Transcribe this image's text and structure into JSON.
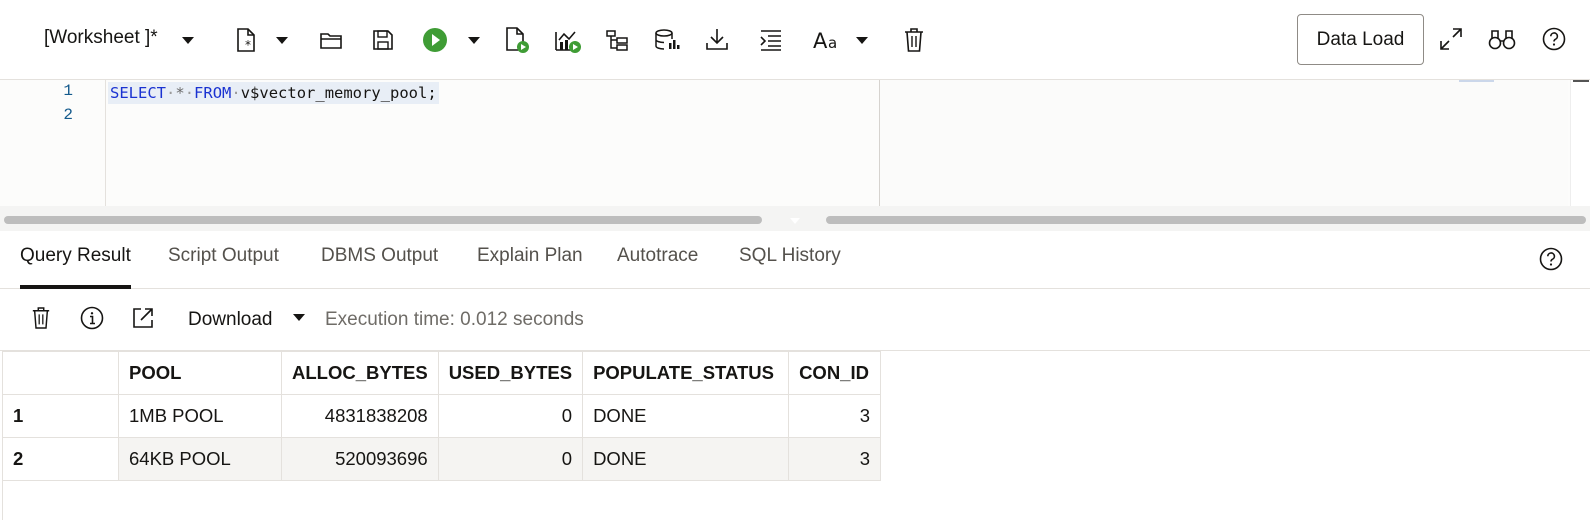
{
  "toolbar": {
    "worksheet_title": "[Worksheet ]*",
    "data_load_label": "Data Load",
    "icons": [
      "new-file-icon",
      "open-folder-icon",
      "save-icon",
      "run-statement-icon",
      "run-script-icon",
      "autotrace-icon",
      "explain-plan-icon",
      "database-icon",
      "download-icon",
      "format-icon",
      "font-icon",
      "delete-icon",
      "expand-icon",
      "find-icon",
      "help-icon"
    ],
    "run_color": "#3f9c35"
  },
  "editor": {
    "line_numbers": [
      "1",
      "2"
    ],
    "code": {
      "kw_select": "SELECT",
      "star": "*",
      "kw_from": "FROM",
      "table": "v$vector_memory_pool;"
    }
  },
  "tabs": [
    {
      "label": "Query Result",
      "active": true
    },
    {
      "label": "Script Output"
    },
    {
      "label": "DBMS Output"
    },
    {
      "label": "Explain Plan"
    },
    {
      "label": "Autotrace"
    },
    {
      "label": "SQL History"
    }
  ],
  "result": {
    "download_label": "Download",
    "execution_time": "Execution time: 0.012 seconds"
  },
  "grid": {
    "columns": [
      "POOL",
      "ALLOC_BYTES",
      "USED_BYTES",
      "POPULATE_STATUS",
      "CON_ID"
    ],
    "rows": [
      {
        "num": "1",
        "pool": "1MB POOL",
        "alloc_bytes": "4831838208",
        "used_bytes": "0",
        "populate_status": "DONE",
        "con_id": "3"
      },
      {
        "num": "2",
        "pool": "64KB POOL",
        "alloc_bytes": "520093696",
        "used_bytes": "0",
        "populate_status": "DONE",
        "con_id": "3"
      }
    ]
  }
}
